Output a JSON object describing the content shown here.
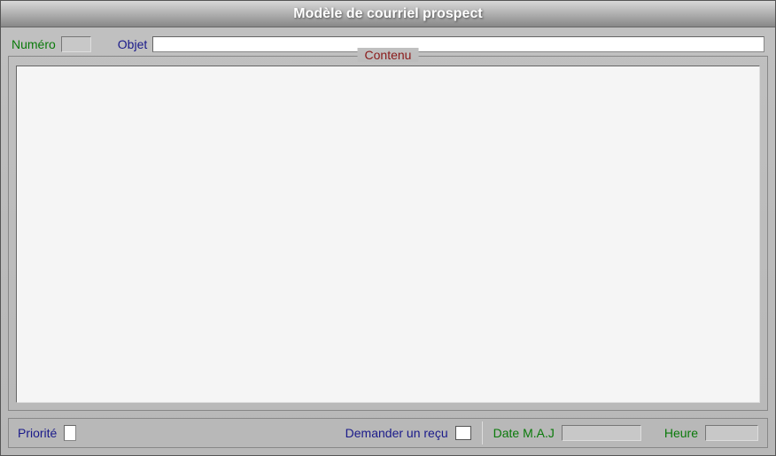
{
  "window": {
    "title": "Modèle de courriel prospect"
  },
  "topRow": {
    "numeroLabel": "Numéro",
    "numeroValue": "",
    "objetLabel": "Objet",
    "objetValue": ""
  },
  "fieldset": {
    "legend": "Contenu",
    "content": ""
  },
  "bottomBar": {
    "prioriteLabel": "Priorité",
    "prioriteValue": "",
    "demanderRecuLabel": "Demander un reçu",
    "demanderRecuChecked": false,
    "dateMajLabel": "Date M.A.J",
    "dateMajValue": "",
    "heureLabel": "Heure",
    "heureValue": ""
  }
}
